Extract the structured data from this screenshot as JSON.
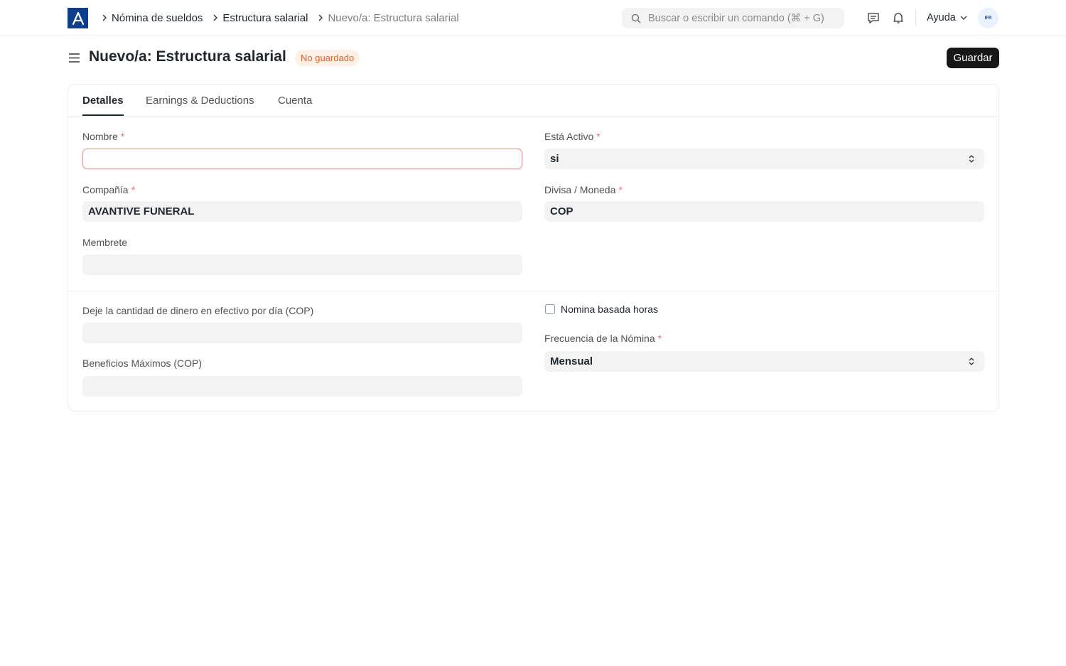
{
  "navbar": {
    "breadcrumbs": [
      "Nómina de sueldos",
      "Estructura salarial",
      "Nuevo/a: Estructura salarial"
    ],
    "search_placeholder": "Buscar o escribir un comando (⌘ + G)",
    "help_label": "Ayuda",
    "avatar_initials": "IFR"
  },
  "page": {
    "title": "Nuevo/a: Estructura salarial",
    "status_badge": "No guardado",
    "save_label": "Guardar"
  },
  "tabs": [
    {
      "label": "Detalles",
      "active": true
    },
    {
      "label": "Earnings & Deductions",
      "active": false
    },
    {
      "label": "Cuenta",
      "active": false
    }
  ],
  "form": {
    "nombre": {
      "label": "Nombre",
      "value": "",
      "required": true
    },
    "esta_activo": {
      "label": "Está Activo",
      "value": "si",
      "required": true
    },
    "compania": {
      "label": "Compañía",
      "value": "AVANTIVE FUNERAL",
      "required": true
    },
    "divisa": {
      "label": "Divisa / Moneda",
      "value": "COP",
      "required": true
    },
    "membrete": {
      "label": "Membrete",
      "value": ""
    },
    "efectivo_dia": {
      "label": "Deje la cantidad de dinero en efectivo por día (COP)",
      "value": ""
    },
    "beneficios_max": {
      "label": "Beneficios Máximos (COP)",
      "value": ""
    },
    "nomina_horas": {
      "label": "Nomina basada horas",
      "checked": false
    },
    "frecuencia": {
      "label": "Frecuencia de la Nómina",
      "value": "Mensual",
      "required": true
    }
  },
  "colors": {
    "logo": "#0b3e8c",
    "badge_text": "#e0632d",
    "badge_bg": "#fff1e7",
    "primary_button": "#171717"
  }
}
